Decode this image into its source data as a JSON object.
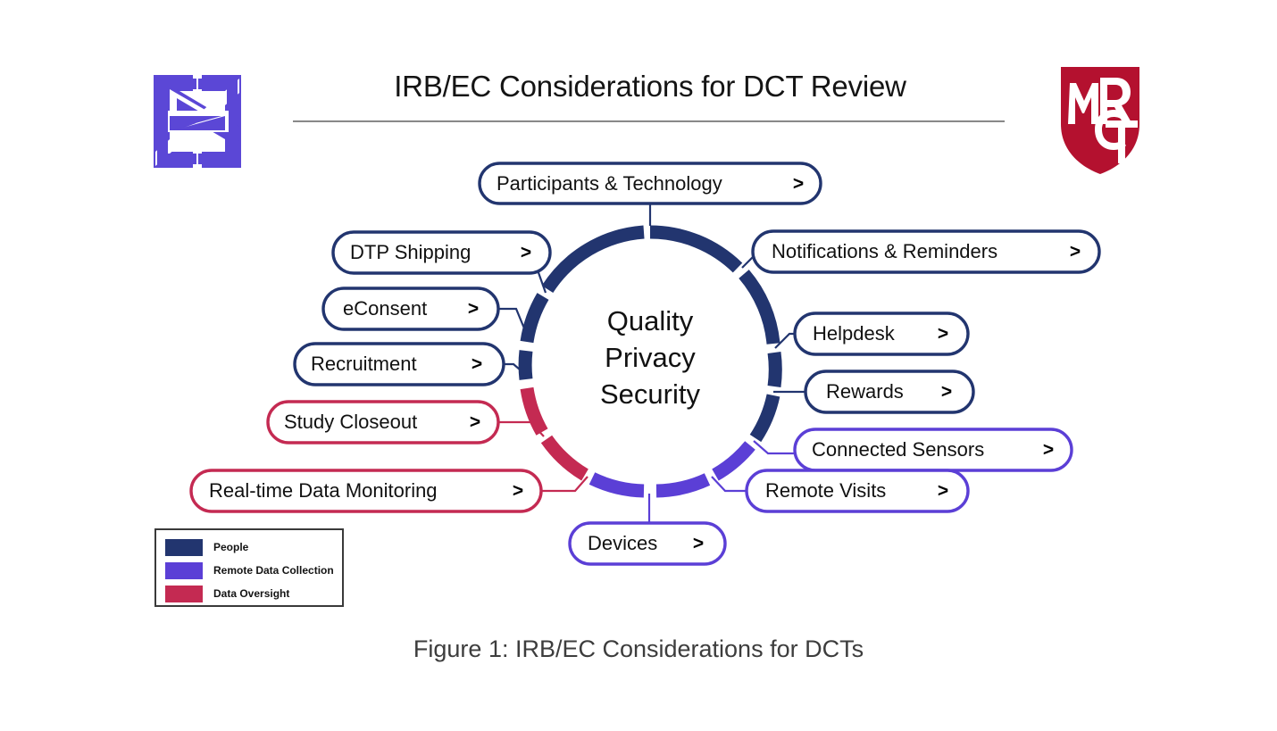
{
  "header": {
    "title": "IRB/EC Considerations for DCT Review",
    "brand_logo_name": "nexus-bowtie-logo",
    "org_logo_name": "mrct-shield-logo",
    "org_logo_text": "MRCT"
  },
  "hub": {
    "lines": [
      "Quality",
      "Privacy",
      "Security"
    ]
  },
  "colors": {
    "people": "#22356F",
    "remote_data_collection": "#5B3FD6",
    "data_oversight": "#C42A52",
    "text": "#111111",
    "caption": "#3D3D3D"
  },
  "nodes": [
    {
      "id": "participants-technology",
      "label": "Participants & Technology",
      "chevron": ">",
      "category": "people",
      "color": "#22356F"
    },
    {
      "id": "notifications-reminders",
      "label": "Notifications & Reminders",
      "chevron": ">",
      "category": "people",
      "color": "#22356F"
    },
    {
      "id": "helpdesk",
      "label": "Helpdesk",
      "chevron": ">",
      "category": "people",
      "color": "#22356F"
    },
    {
      "id": "rewards",
      "label": "Rewards",
      "chevron": ">",
      "category": "people",
      "color": "#22356F"
    },
    {
      "id": "connected-sensors",
      "label": "Connected Sensors",
      "chevron": ">",
      "category": "remote_data_collection",
      "color": "#5B3FD6"
    },
    {
      "id": "remote-visits",
      "label": "Remote Visits",
      "chevron": ">",
      "category": "remote_data_collection",
      "color": "#5B3FD6"
    },
    {
      "id": "devices",
      "label": "Devices",
      "chevron": ">",
      "category": "remote_data_collection",
      "color": "#5B3FD6"
    },
    {
      "id": "real-time-data-monitoring",
      "label": "Real-time Data Monitoring",
      "chevron": ">",
      "category": "data_oversight",
      "color": "#C42A52"
    },
    {
      "id": "study-closeout",
      "label": "Study Closeout",
      "chevron": ">",
      "category": "data_oversight",
      "color": "#C42A52"
    },
    {
      "id": "recruitment",
      "label": "Recruitment",
      "chevron": ">",
      "category": "people",
      "color": "#22356F"
    },
    {
      "id": "econsent",
      "label": "eConsent",
      "chevron": ">",
      "category": "people",
      "color": "#22356F"
    },
    {
      "id": "dtp-shipping",
      "label": "DTP Shipping",
      "chevron": ">",
      "category": "people",
      "color": "#22356F"
    }
  ],
  "legend": {
    "items": [
      {
        "label": "People",
        "color": "#22356F"
      },
      {
        "label": "Remote Data Collection",
        "color": "#5B3FD6"
      },
      {
        "label": "Data Oversight",
        "color": "#C42A52"
      }
    ]
  },
  "caption": "Figure 1: IRB/EC Considerations for DCTs"
}
